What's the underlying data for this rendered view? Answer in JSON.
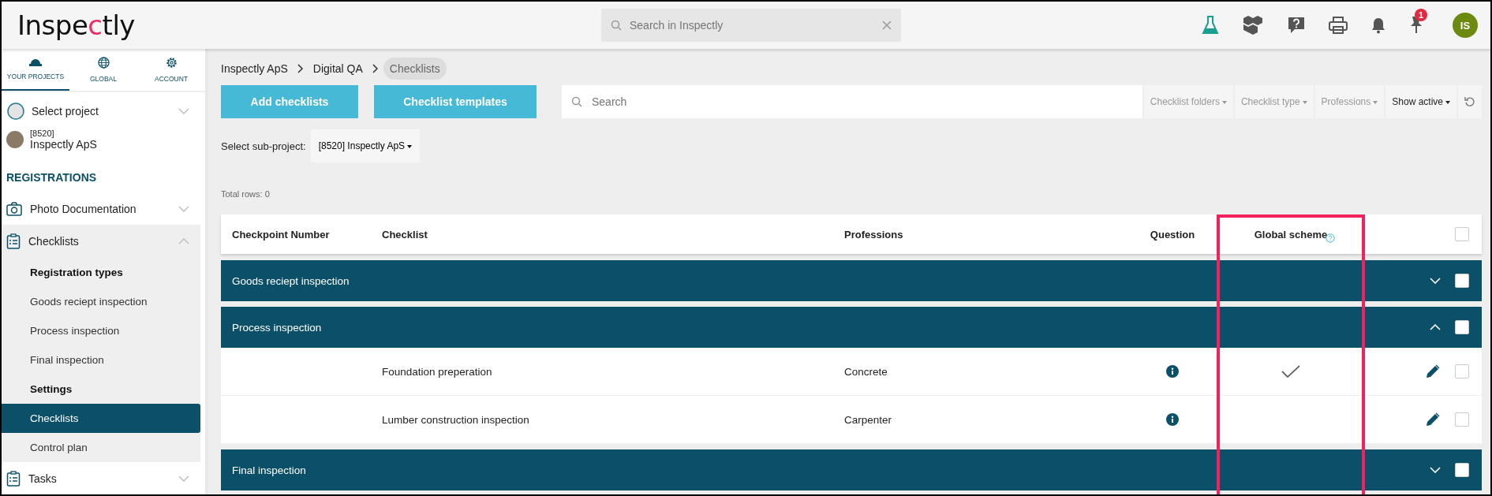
{
  "header": {
    "logo": "Inspectly",
    "search_placeholder": "Search in Inspectly",
    "notification_count": "1",
    "avatar": "IS"
  },
  "sidebar": {
    "tabs": [
      {
        "label": "YOUR PROJECTS",
        "selected": true
      },
      {
        "label": "GLOBAL",
        "selected": false
      },
      {
        "label": "ACCOUNT",
        "selected": false
      }
    ],
    "select_project": "Select project",
    "project": {
      "code": "[8520]",
      "name": "Inspectly ApS"
    },
    "section_title": "REGISTRATIONS",
    "items": [
      {
        "label": "Photo Documentation",
        "expanded": false
      },
      {
        "label": "Checklists",
        "expanded": true,
        "children": [
          {
            "label": "Registration types",
            "kind": "heading",
            "selected": false
          },
          {
            "label": "Goods reciept inspection",
            "kind": "link",
            "selected": false
          },
          {
            "label": "Process inspection",
            "kind": "link",
            "selected": false
          },
          {
            "label": "Final inspection",
            "kind": "link",
            "selected": false
          },
          {
            "label": "Settings",
            "kind": "heading",
            "selected": false
          },
          {
            "label": "Checklists",
            "kind": "link",
            "selected": true
          },
          {
            "label": "Control plan",
            "kind": "link",
            "selected": false
          }
        ]
      },
      {
        "label": "Tasks",
        "expanded": false
      }
    ]
  },
  "breadcrumb": [
    {
      "label": "Inspectly ApS",
      "current": false
    },
    {
      "label": "Digital QA",
      "current": false
    },
    {
      "label": "Checklists",
      "current": true
    }
  ],
  "buttons": [
    "Add checklists",
    "Checklist templates"
  ],
  "search_placeholder": "Search",
  "filters": [
    {
      "label": "Checklist folders",
      "active": false
    },
    {
      "label": "Checklist type",
      "active": false
    },
    {
      "label": "Professions",
      "active": false
    },
    {
      "label": "Show active",
      "active": true
    }
  ],
  "sub_project": {
    "label": "Select sub-project:",
    "value": "[8520] Inspectly ApS"
  },
  "total_rows": "Total rows: 0",
  "table": {
    "columns": [
      {
        "label": "Checkpoint Number",
        "highlighted": false
      },
      {
        "label": "Checklist",
        "highlighted": false
      },
      {
        "label": "Professions",
        "highlighted": false
      },
      {
        "label": "Question",
        "highlighted": false
      },
      {
        "label": "Global scheme",
        "highlighted": true
      }
    ],
    "header_checked": false,
    "groups": [
      {
        "name": "Goods reciept inspection",
        "expanded": false,
        "checked": false
      },
      {
        "name": "Process inspection",
        "expanded": true,
        "checked": false,
        "rows": [
          {
            "checklist": "Foundation preperation",
            "profession": "Concrete",
            "global_scheme": true,
            "checked": false
          },
          {
            "checklist": "Lumber construction inspection",
            "profession": "Carpenter",
            "global_scheme": false,
            "checked": false
          }
        ]
      },
      {
        "name": "Final inspection",
        "expanded": false,
        "checked": false
      }
    ]
  }
}
